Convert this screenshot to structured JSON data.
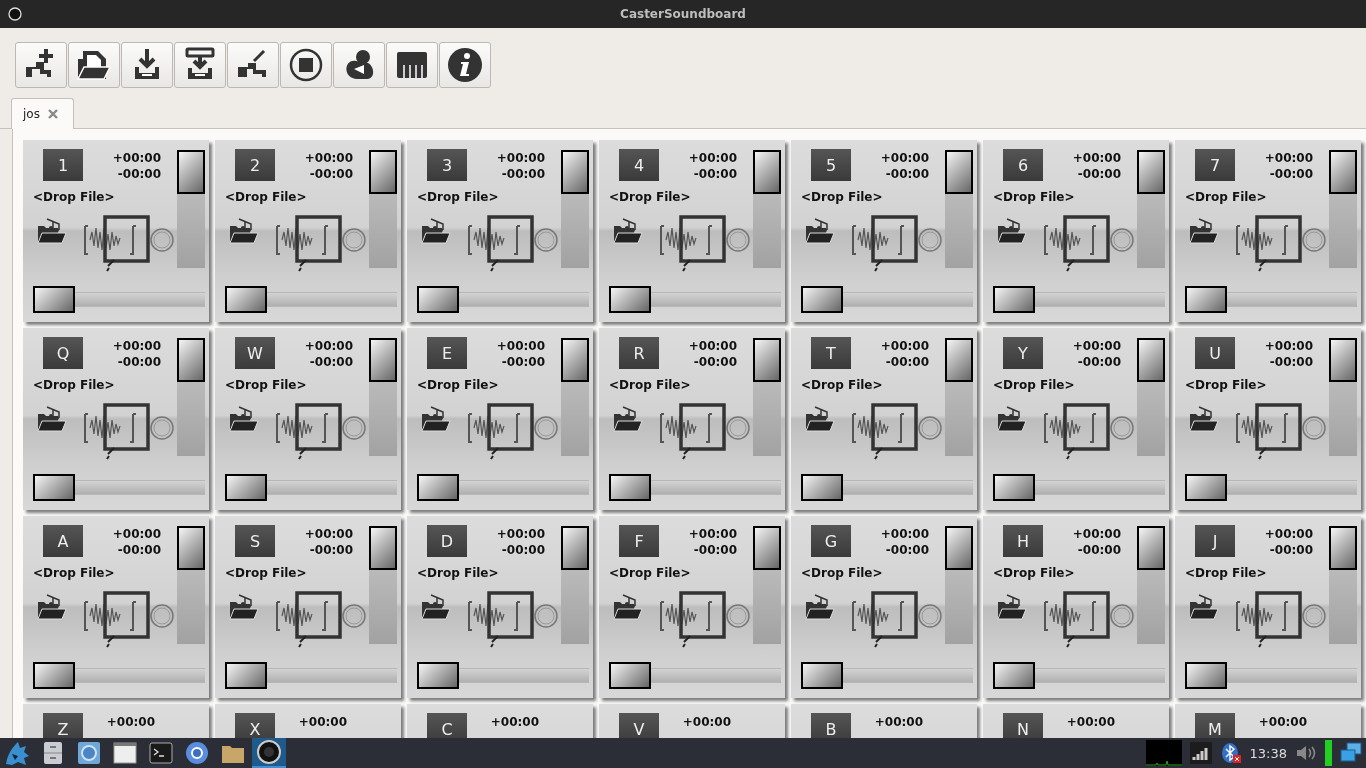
{
  "window": {
    "title": "CasterSoundboard"
  },
  "toolbar": [
    {
      "kind": "new-tab"
    },
    {
      "kind": "open"
    },
    {
      "kind": "save"
    },
    {
      "kind": "save-as"
    },
    {
      "kind": "rename"
    },
    {
      "kind": "stop"
    },
    {
      "kind": "duck"
    },
    {
      "kind": "piano"
    },
    {
      "kind": "info"
    }
  ],
  "tabs": [
    {
      "label": "jos",
      "selected": true
    }
  ],
  "cells": [
    {
      "key": "1",
      "elapsed": "+00:00",
      "remaining": "-00:00",
      "file": "<Drop File>",
      "volume_slider": {
        "level": 1
      },
      "position_slider": {
        "level": 0
      }
    },
    {
      "key": "2",
      "elapsed": "+00:00",
      "remaining": "-00:00",
      "file": "<Drop File>",
      "volume_slider": {
        "level": 1
      },
      "position_slider": {
        "level": 0
      }
    },
    {
      "key": "3",
      "elapsed": "+00:00",
      "remaining": "-00:00",
      "file": "<Drop File>",
      "volume_slider": {
        "level": 1
      },
      "position_slider": {
        "level": 0
      }
    },
    {
      "key": "4",
      "elapsed": "+00:00",
      "remaining": "-00:00",
      "file": "<Drop File>",
      "volume_slider": {
        "level": 1
      },
      "position_slider": {
        "level": 0
      }
    },
    {
      "key": "5",
      "elapsed": "+00:00",
      "remaining": "-00:00",
      "file": "<Drop File>",
      "volume_slider": {
        "level": 1
      },
      "position_slider": {
        "level": 0
      }
    },
    {
      "key": "6",
      "elapsed": "+00:00",
      "remaining": "-00:00",
      "file": "<Drop File>",
      "volume_slider": {
        "level": 1
      },
      "position_slider": {
        "level": 0
      }
    },
    {
      "key": "7",
      "elapsed": "+00:00",
      "remaining": "-00:00",
      "file": "<Drop File>",
      "volume_slider": {
        "level": 1
      },
      "position_slider": {
        "level": 0
      }
    },
    {
      "key": "Q",
      "elapsed": "+00:00",
      "remaining": "-00:00",
      "file": "<Drop File>",
      "volume_slider": {
        "level": 1
      },
      "position_slider": {
        "level": 0
      }
    },
    {
      "key": "W",
      "elapsed": "+00:00",
      "remaining": "-00:00",
      "file": "<Drop File>",
      "volume_slider": {
        "level": 1
      },
      "position_slider": {
        "level": 0
      }
    },
    {
      "key": "E",
      "elapsed": "+00:00",
      "remaining": "-00:00",
      "file": "<Drop File>",
      "volume_slider": {
        "level": 1
      },
      "position_slider": {
        "level": 0
      }
    },
    {
      "key": "R",
      "elapsed": "+00:00",
      "remaining": "-00:00",
      "file": "<Drop File>",
      "volume_slider": {
        "level": 1
      },
      "position_slider": {
        "level": 0
      }
    },
    {
      "key": "T",
      "elapsed": "+00:00",
      "remaining": "-00:00",
      "file": "<Drop File>",
      "volume_slider": {
        "level": 1
      },
      "position_slider": {
        "level": 0
      }
    },
    {
      "key": "Y",
      "elapsed": "+00:00",
      "remaining": "-00:00",
      "file": "<Drop File>",
      "volume_slider": {
        "level": 1
      },
      "position_slider": {
        "level": 0
      }
    },
    {
      "key": "U",
      "elapsed": "+00:00",
      "remaining": "-00:00",
      "file": "<Drop File>",
      "volume_slider": {
        "level": 1
      },
      "position_slider": {
        "level": 0
      }
    },
    {
      "key": "A",
      "elapsed": "+00:00",
      "remaining": "-00:00",
      "file": "<Drop File>",
      "volume_slider": {
        "level": 1
      },
      "position_slider": {
        "level": 0
      }
    },
    {
      "key": "S",
      "elapsed": "+00:00",
      "remaining": "-00:00",
      "file": "<Drop File>",
      "volume_slider": {
        "level": 1
      },
      "position_slider": {
        "level": 0
      }
    },
    {
      "key": "D",
      "elapsed": "+00:00",
      "remaining": "-00:00",
      "file": "<Drop File>",
      "volume_slider": {
        "level": 1
      },
      "position_slider": {
        "level": 0
      }
    },
    {
      "key": "F",
      "elapsed": "+00:00",
      "remaining": "-00:00",
      "file": "<Drop File>",
      "volume_slider": {
        "level": 1
      },
      "position_slider": {
        "level": 0
      }
    },
    {
      "key": "G",
      "elapsed": "+00:00",
      "remaining": "-00:00",
      "file": "<Drop File>",
      "volume_slider": {
        "level": 1
      },
      "position_slider": {
        "level": 0
      }
    },
    {
      "key": "H",
      "elapsed": "+00:00",
      "remaining": "-00:00",
      "file": "<Drop File>",
      "volume_slider": {
        "level": 1
      },
      "position_slider": {
        "level": 0
      }
    },
    {
      "key": "J",
      "elapsed": "+00:00",
      "remaining": "-00:00",
      "file": "<Drop File>",
      "volume_slider": {
        "level": 1
      },
      "position_slider": {
        "level": 0
      }
    },
    {
      "key": "Z",
      "elapsed": "+00:00"
    },
    {
      "key": "X",
      "elapsed": "+00:00"
    },
    {
      "key": "C",
      "elapsed": "+00:00"
    },
    {
      "key": "V",
      "elapsed": "+00:00"
    },
    {
      "key": "B",
      "elapsed": "+00:00"
    },
    {
      "key": "N",
      "elapsed": "+00:00"
    },
    {
      "key": "M",
      "elapsed": "+00:00"
    }
  ],
  "taskbar": {
    "apps": [
      {
        "kind": "dragon",
        "selected": false
      },
      {
        "kind": "cabinet",
        "selected": false
      },
      {
        "kind": "browser",
        "selected": false
      },
      {
        "kind": "window",
        "selected": false
      },
      {
        "kind": "terminal",
        "selected": false
      },
      {
        "kind": "chromium",
        "selected": false
      },
      {
        "kind": "folder",
        "selected": false
      },
      {
        "kind": "speaker",
        "selected": true
      }
    ],
    "tray": {
      "clock": "13:38"
    }
  }
}
